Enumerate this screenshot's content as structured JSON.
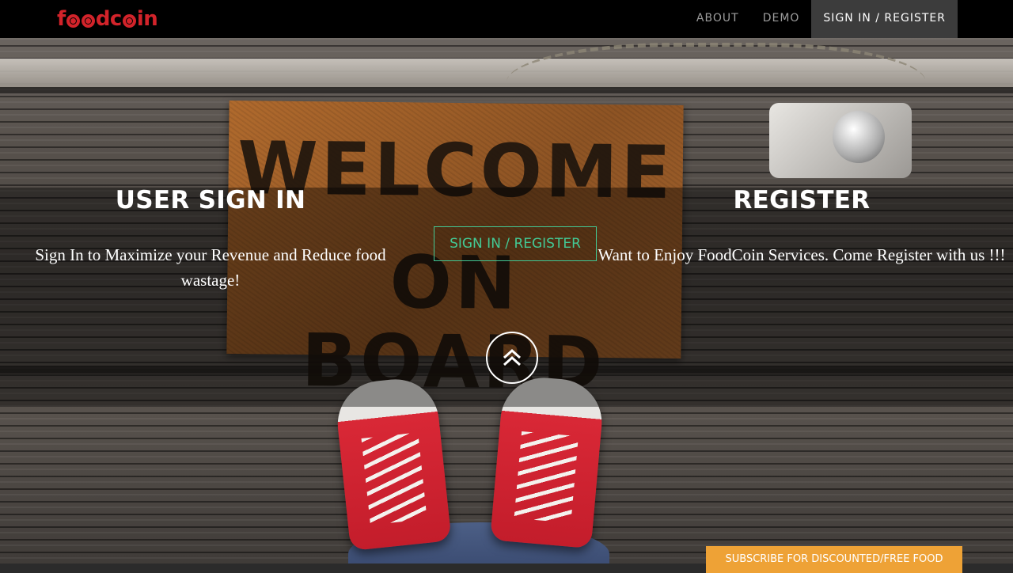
{
  "navbar": {
    "brand": "foodcoin",
    "brand_parts": [
      "f",
      "dc",
      "in"
    ],
    "links": [
      {
        "label": "ABOUT"
      },
      {
        "label": "DEMO"
      },
      {
        "label": "SIGN IN / REGISTER"
      }
    ],
    "active_link": "SIGN IN / REGISTER"
  },
  "background": {
    "doormat_lines": [
      "WELCOME",
      "ON BOARD"
    ]
  },
  "sign_in": {
    "title": "USER SIGN IN",
    "text": "Sign In to Maximize your Revenue and Reduce food wastage!"
  },
  "register": {
    "title": "REGISTER",
    "text": "Want to Enjoy FoodCoin Services. Come Register with us !!!"
  },
  "cta": {
    "label": "SIGN IN / REGISTER"
  },
  "scroll_up": {
    "icon": "double-chevron-up-icon"
  },
  "subscribe": {
    "label": "SUBSCRIBE FOR DISCOUNTED/FREE FOOD"
  },
  "colors": {
    "brand": "#d2232a",
    "cta_accent": "#43c995",
    "subscribe_bg": "#eea236",
    "navbar_bg": "#000000"
  }
}
